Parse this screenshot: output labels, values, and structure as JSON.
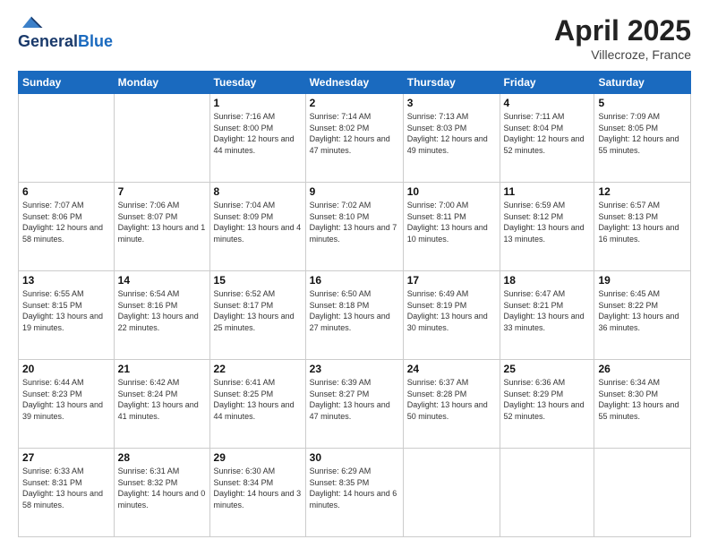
{
  "header": {
    "logo_line1": "General",
    "logo_line2": "Blue",
    "title": "April 2025",
    "subtitle": "Villecroze, France"
  },
  "weekdays": [
    "Sunday",
    "Monday",
    "Tuesday",
    "Wednesday",
    "Thursday",
    "Friday",
    "Saturday"
  ],
  "weeks": [
    [
      {
        "day": "",
        "sunrise": "",
        "sunset": "",
        "daylight": ""
      },
      {
        "day": "",
        "sunrise": "",
        "sunset": "",
        "daylight": ""
      },
      {
        "day": "1",
        "sunrise": "Sunrise: 7:16 AM",
        "sunset": "Sunset: 8:00 PM",
        "daylight": "Daylight: 12 hours and 44 minutes."
      },
      {
        "day": "2",
        "sunrise": "Sunrise: 7:14 AM",
        "sunset": "Sunset: 8:02 PM",
        "daylight": "Daylight: 12 hours and 47 minutes."
      },
      {
        "day": "3",
        "sunrise": "Sunrise: 7:13 AM",
        "sunset": "Sunset: 8:03 PM",
        "daylight": "Daylight: 12 hours and 49 minutes."
      },
      {
        "day": "4",
        "sunrise": "Sunrise: 7:11 AM",
        "sunset": "Sunset: 8:04 PM",
        "daylight": "Daylight: 12 hours and 52 minutes."
      },
      {
        "day": "5",
        "sunrise": "Sunrise: 7:09 AM",
        "sunset": "Sunset: 8:05 PM",
        "daylight": "Daylight: 12 hours and 55 minutes."
      }
    ],
    [
      {
        "day": "6",
        "sunrise": "Sunrise: 7:07 AM",
        "sunset": "Sunset: 8:06 PM",
        "daylight": "Daylight: 12 hours and 58 minutes."
      },
      {
        "day": "7",
        "sunrise": "Sunrise: 7:06 AM",
        "sunset": "Sunset: 8:07 PM",
        "daylight": "Daylight: 13 hours and 1 minute."
      },
      {
        "day": "8",
        "sunrise": "Sunrise: 7:04 AM",
        "sunset": "Sunset: 8:09 PM",
        "daylight": "Daylight: 13 hours and 4 minutes."
      },
      {
        "day": "9",
        "sunrise": "Sunrise: 7:02 AM",
        "sunset": "Sunset: 8:10 PM",
        "daylight": "Daylight: 13 hours and 7 minutes."
      },
      {
        "day": "10",
        "sunrise": "Sunrise: 7:00 AM",
        "sunset": "Sunset: 8:11 PM",
        "daylight": "Daylight: 13 hours and 10 minutes."
      },
      {
        "day": "11",
        "sunrise": "Sunrise: 6:59 AM",
        "sunset": "Sunset: 8:12 PM",
        "daylight": "Daylight: 13 hours and 13 minutes."
      },
      {
        "day": "12",
        "sunrise": "Sunrise: 6:57 AM",
        "sunset": "Sunset: 8:13 PM",
        "daylight": "Daylight: 13 hours and 16 minutes."
      }
    ],
    [
      {
        "day": "13",
        "sunrise": "Sunrise: 6:55 AM",
        "sunset": "Sunset: 8:15 PM",
        "daylight": "Daylight: 13 hours and 19 minutes."
      },
      {
        "day": "14",
        "sunrise": "Sunrise: 6:54 AM",
        "sunset": "Sunset: 8:16 PM",
        "daylight": "Daylight: 13 hours and 22 minutes."
      },
      {
        "day": "15",
        "sunrise": "Sunrise: 6:52 AM",
        "sunset": "Sunset: 8:17 PM",
        "daylight": "Daylight: 13 hours and 25 minutes."
      },
      {
        "day": "16",
        "sunrise": "Sunrise: 6:50 AM",
        "sunset": "Sunset: 8:18 PM",
        "daylight": "Daylight: 13 hours and 27 minutes."
      },
      {
        "day": "17",
        "sunrise": "Sunrise: 6:49 AM",
        "sunset": "Sunset: 8:19 PM",
        "daylight": "Daylight: 13 hours and 30 minutes."
      },
      {
        "day": "18",
        "sunrise": "Sunrise: 6:47 AM",
        "sunset": "Sunset: 8:21 PM",
        "daylight": "Daylight: 13 hours and 33 minutes."
      },
      {
        "day": "19",
        "sunrise": "Sunrise: 6:45 AM",
        "sunset": "Sunset: 8:22 PM",
        "daylight": "Daylight: 13 hours and 36 minutes."
      }
    ],
    [
      {
        "day": "20",
        "sunrise": "Sunrise: 6:44 AM",
        "sunset": "Sunset: 8:23 PM",
        "daylight": "Daylight: 13 hours and 39 minutes."
      },
      {
        "day": "21",
        "sunrise": "Sunrise: 6:42 AM",
        "sunset": "Sunset: 8:24 PM",
        "daylight": "Daylight: 13 hours and 41 minutes."
      },
      {
        "day": "22",
        "sunrise": "Sunrise: 6:41 AM",
        "sunset": "Sunset: 8:25 PM",
        "daylight": "Daylight: 13 hours and 44 minutes."
      },
      {
        "day": "23",
        "sunrise": "Sunrise: 6:39 AM",
        "sunset": "Sunset: 8:27 PM",
        "daylight": "Daylight: 13 hours and 47 minutes."
      },
      {
        "day": "24",
        "sunrise": "Sunrise: 6:37 AM",
        "sunset": "Sunset: 8:28 PM",
        "daylight": "Daylight: 13 hours and 50 minutes."
      },
      {
        "day": "25",
        "sunrise": "Sunrise: 6:36 AM",
        "sunset": "Sunset: 8:29 PM",
        "daylight": "Daylight: 13 hours and 52 minutes."
      },
      {
        "day": "26",
        "sunrise": "Sunrise: 6:34 AM",
        "sunset": "Sunset: 8:30 PM",
        "daylight": "Daylight: 13 hours and 55 minutes."
      }
    ],
    [
      {
        "day": "27",
        "sunrise": "Sunrise: 6:33 AM",
        "sunset": "Sunset: 8:31 PM",
        "daylight": "Daylight: 13 hours and 58 minutes."
      },
      {
        "day": "28",
        "sunrise": "Sunrise: 6:31 AM",
        "sunset": "Sunset: 8:32 PM",
        "daylight": "Daylight: 14 hours and 0 minutes."
      },
      {
        "day": "29",
        "sunrise": "Sunrise: 6:30 AM",
        "sunset": "Sunset: 8:34 PM",
        "daylight": "Daylight: 14 hours and 3 minutes."
      },
      {
        "day": "30",
        "sunrise": "Sunrise: 6:29 AM",
        "sunset": "Sunset: 8:35 PM",
        "daylight": "Daylight: 14 hours and 6 minutes."
      },
      {
        "day": "",
        "sunrise": "",
        "sunset": "",
        "daylight": ""
      },
      {
        "day": "",
        "sunrise": "",
        "sunset": "",
        "daylight": ""
      },
      {
        "day": "",
        "sunrise": "",
        "sunset": "",
        "daylight": ""
      }
    ]
  ]
}
